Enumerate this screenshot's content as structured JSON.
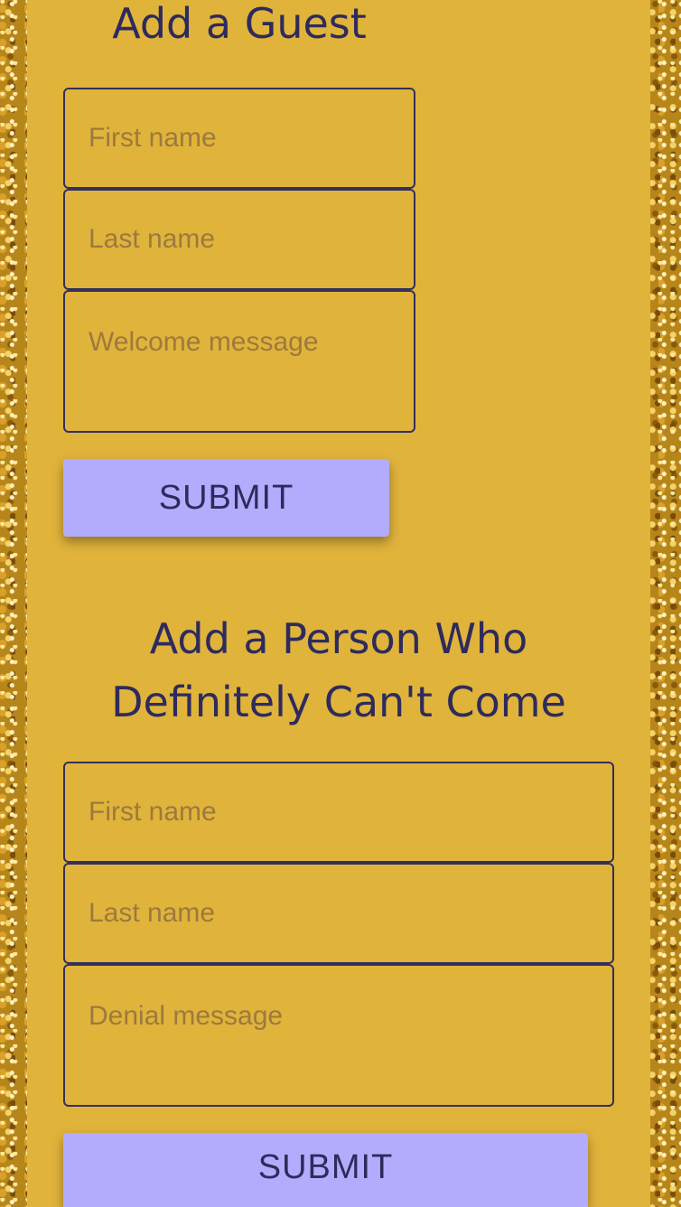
{
  "guest_form": {
    "title": "Add a Guest",
    "first_name_placeholder": "First name",
    "last_name_placeholder": "Last name",
    "message_placeholder": "Welcome message",
    "submit_label": "SUBMIT"
  },
  "cant_come_form": {
    "title": "Add a Person Who Definitely Can't Come",
    "first_name_placeholder": "First name",
    "last_name_placeholder": "Last name",
    "message_placeholder": "Denial message",
    "submit_label": "SUBMIT"
  },
  "colors": {
    "panel": "#e0b33b",
    "text": "#2e2b5c",
    "button": "#b3acfd",
    "placeholder": "#9c7a3d"
  }
}
